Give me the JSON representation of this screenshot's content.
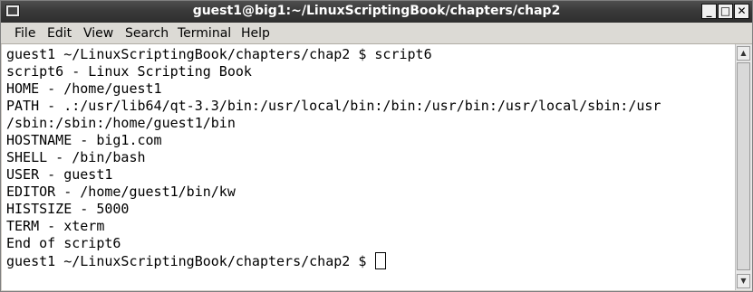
{
  "window": {
    "title": "guest1@big1:~/LinuxScriptingBook/chapters/chap2",
    "minimize_glyph": "_",
    "maximize_glyph": "□",
    "close_glyph": "✕"
  },
  "menubar": {
    "items": [
      "File",
      "Edit",
      "View",
      "Search",
      "Terminal",
      "Help"
    ]
  },
  "terminal": {
    "lines": [
      "guest1 ~/LinuxScriptingBook/chapters/chap2 $ script6",
      "script6 - Linux Scripting Book",
      "HOME - /home/guest1",
      "PATH - .:/usr/lib64/qt-3.3/bin:/usr/local/bin:/bin:/usr/bin:/usr/local/sbin:/usr",
      "/sbin:/sbin:/home/guest1/bin",
      "HOSTNAME - big1.com",
      "SHELL - /bin/bash",
      "USER - guest1",
      "EDITOR - /home/guest1/bin/kw",
      "HISTSIZE - 5000",
      "TERM - xterm",
      "End of script6"
    ],
    "prompt": "guest1 ~/LinuxScriptingBook/chapters/chap2 $ "
  },
  "scrollbar": {
    "up_glyph": "▲",
    "down_glyph": "▼"
  }
}
